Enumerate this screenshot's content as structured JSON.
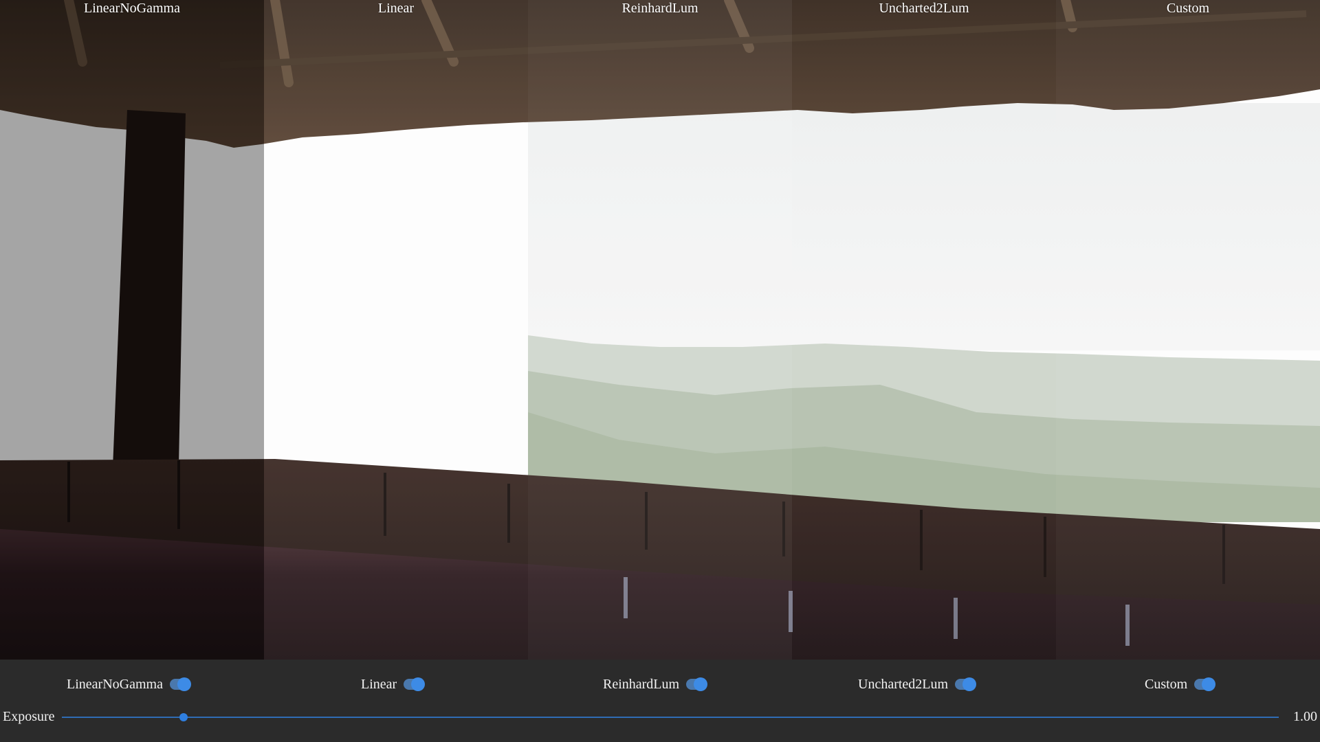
{
  "panels": [
    {
      "label": "LinearNoGamma"
    },
    {
      "label": "Linear"
    },
    {
      "label": "ReinhardLum"
    },
    {
      "label": "Uncharted2Lum"
    },
    {
      "label": "Custom"
    }
  ],
  "toggles": [
    {
      "label": "LinearNoGamma",
      "checked": true
    },
    {
      "label": "Linear",
      "checked": true
    },
    {
      "label": "ReinhardLum",
      "checked": true
    },
    {
      "label": "Uncharted2Lum",
      "checked": true
    },
    {
      "label": "Custom",
      "checked": true
    }
  ],
  "exposure": {
    "label": "Exposure",
    "value_text": "1.00",
    "value_fraction": 0.1
  },
  "colors": {
    "toggle_track": "#4a78ad",
    "toggle_knob": "#3d8be6",
    "slider_accent": "#2f7fe0",
    "control_bar_bg": "#2b2b2b"
  }
}
